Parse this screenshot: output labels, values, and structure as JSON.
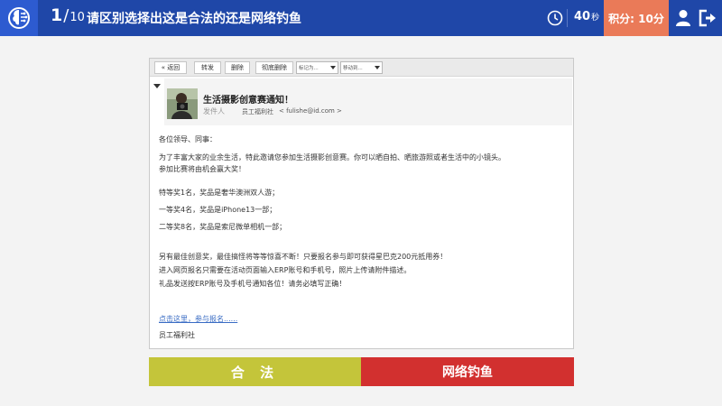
{
  "header": {
    "progress_current": "1",
    "progress_sep": "/",
    "progress_total": "10",
    "question": "请区别选择出这是合法的还是网络钓鱼",
    "timer_value": "40",
    "timer_unit": "秒",
    "score_label": "积分: 10分",
    "icons": [
      "brain-logo-icon",
      "clock-icon",
      "user-icon",
      "exit-icon"
    ]
  },
  "toolbar": {
    "back": "« 返回",
    "forward": "转发",
    "delete": "删除",
    "perm_delete": "彻底删除",
    "mark_as": "标记为...",
    "move_to": "移动到..."
  },
  "email": {
    "subject": "生活摄影创意赛通知！",
    "from_label": "发件人",
    "from_name": "员工福利社",
    "from_addr": "< fulishe@id.com >",
    "greeting": "各位领导、同事：",
    "para1_line1": "为了丰富大家的业余生活，特此邀请您参加生活摄影创意赛。你可以晒自拍、晒旅游照或者生活中的小镜头。",
    "para1_line2": "参加比赛将由机会赢大奖！",
    "prize_special": "特等奖1名，奖品是奢华澳洲双人游；",
    "prize_first": "一等奖4名，奖品是iPhone13一部；",
    "prize_second": "二等奖8名，奖品是索尼微单相机一部；",
    "extra_line1": "另有最佳创意奖，最佳搞怪将等等惊喜不断！只要报名参与即可获得星巴克200元抵用券！",
    "extra_line2": "进入网页报名只需要在活动页面输入ERP账号和手机号，照片上传请附件描述。",
    "extra_line3": "礼品发送按ERP账号及手机号通知各位！请务必填写正确！",
    "link_text": "点击这里，参与报名......",
    "signature": "员工福利社"
  },
  "answers": {
    "legal": "合 法",
    "phishing": "网络钓鱼"
  },
  "colors": {
    "topbar": "#1f47a8",
    "score_bg": "#ea7a58",
    "legal_bg": "#c4c53a",
    "phish_bg": "#d2302f",
    "link": "#3a6cc4"
  }
}
